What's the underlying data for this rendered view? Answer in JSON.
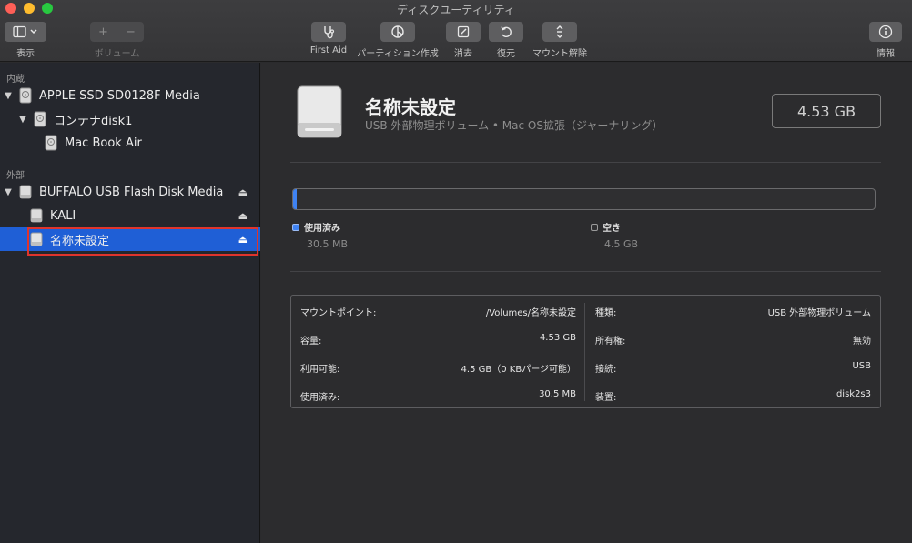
{
  "window": {
    "title": "ディスクユーティリティ"
  },
  "toolbar": {
    "view_label": "表示",
    "volume_label": "ボリューム",
    "first_aid_label": "First Aid",
    "partition_label": "パーティション作成",
    "erase_label": "消去",
    "restore_label": "復元",
    "unmount_label": "マウント解除",
    "info_label": "情報"
  },
  "sidebar": {
    "internal_header": "内蔵",
    "external_header": "外部",
    "items": [
      {
        "label": "APPLE SSD SD0128F Media"
      },
      {
        "label": "コンテナdisk1"
      },
      {
        "label": "Mac Book Air"
      },
      {
        "label": "BUFFALO USB Flash Disk Media"
      },
      {
        "label": "KALI"
      },
      {
        "label": "名称未設定"
      }
    ]
  },
  "main": {
    "volume_name": "名称未設定",
    "volume_subtitle": "USB 外部物理ボリューム • Mac OS拡張（ジャーナリング）",
    "capacity_display": "4.53 GB",
    "usage": {
      "used_fraction": 0.007,
      "used_label": "使用済み",
      "used_value": "30.5 MB",
      "free_label": "空き",
      "free_value": "4.5 GB",
      "used_color": "#3f83f3"
    },
    "info_left": [
      {
        "key": "マウントポイント:",
        "value": "/Volumes/名称未設定"
      },
      {
        "key": "容量:",
        "value": "4.53 GB"
      },
      {
        "key": "利用可能:",
        "value": "4.5 GB（0 KBパージ可能）"
      },
      {
        "key": "使用済み:",
        "value": "30.5 MB"
      }
    ],
    "info_right": [
      {
        "key": "種類:",
        "value": "USB 外部物理ボリューム"
      },
      {
        "key": "所有権:",
        "value": "無効"
      },
      {
        "key": "接続:",
        "value": "USB"
      },
      {
        "key": "装置:",
        "value": "disk2s3"
      }
    ]
  }
}
